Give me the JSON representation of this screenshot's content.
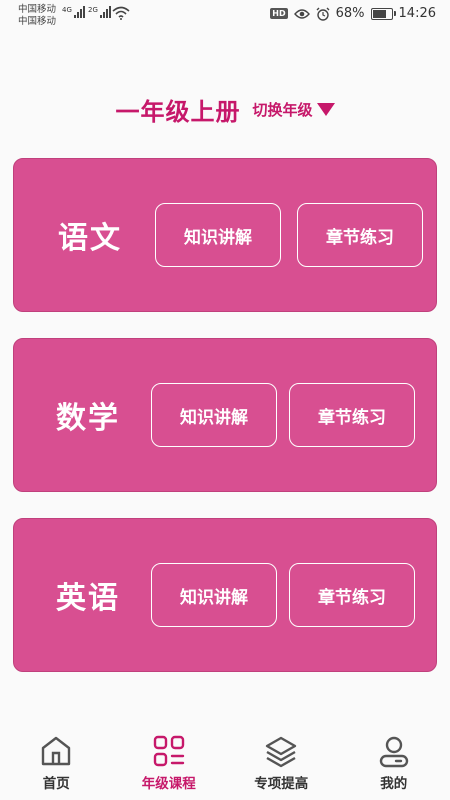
{
  "status_bar": {
    "carrier_1": "中国移动",
    "carrier_2": "中国移动",
    "signal_1_tag": "4G",
    "signal_2_tag": "2G",
    "hd_badge": "HD",
    "battery": "68%",
    "battery_level": 0.68,
    "time": "14:26"
  },
  "header": {
    "grade_title": "一年级上册",
    "switch_label": "切换年级"
  },
  "subjects": [
    {
      "name": "语文",
      "btn_knowledge": "知识讲解",
      "btn_chapter": "章节练习"
    },
    {
      "name": "数学",
      "btn_knowledge": "知识讲解",
      "btn_chapter": "章节练习"
    },
    {
      "name": "英语",
      "btn_knowledge": "知识讲解",
      "btn_chapter": "章节练习"
    }
  ],
  "nav": {
    "items": [
      {
        "label": "首页",
        "icon": "home-icon"
      },
      {
        "label": "年级课程",
        "icon": "grid-list-icon"
      },
      {
        "label": "专项提高",
        "icon": "layers-icon"
      },
      {
        "label": "我的",
        "icon": "user-icon"
      }
    ],
    "active_index": 1
  },
  "colors": {
    "accent": "#c6186a",
    "card": "#d84f91"
  }
}
